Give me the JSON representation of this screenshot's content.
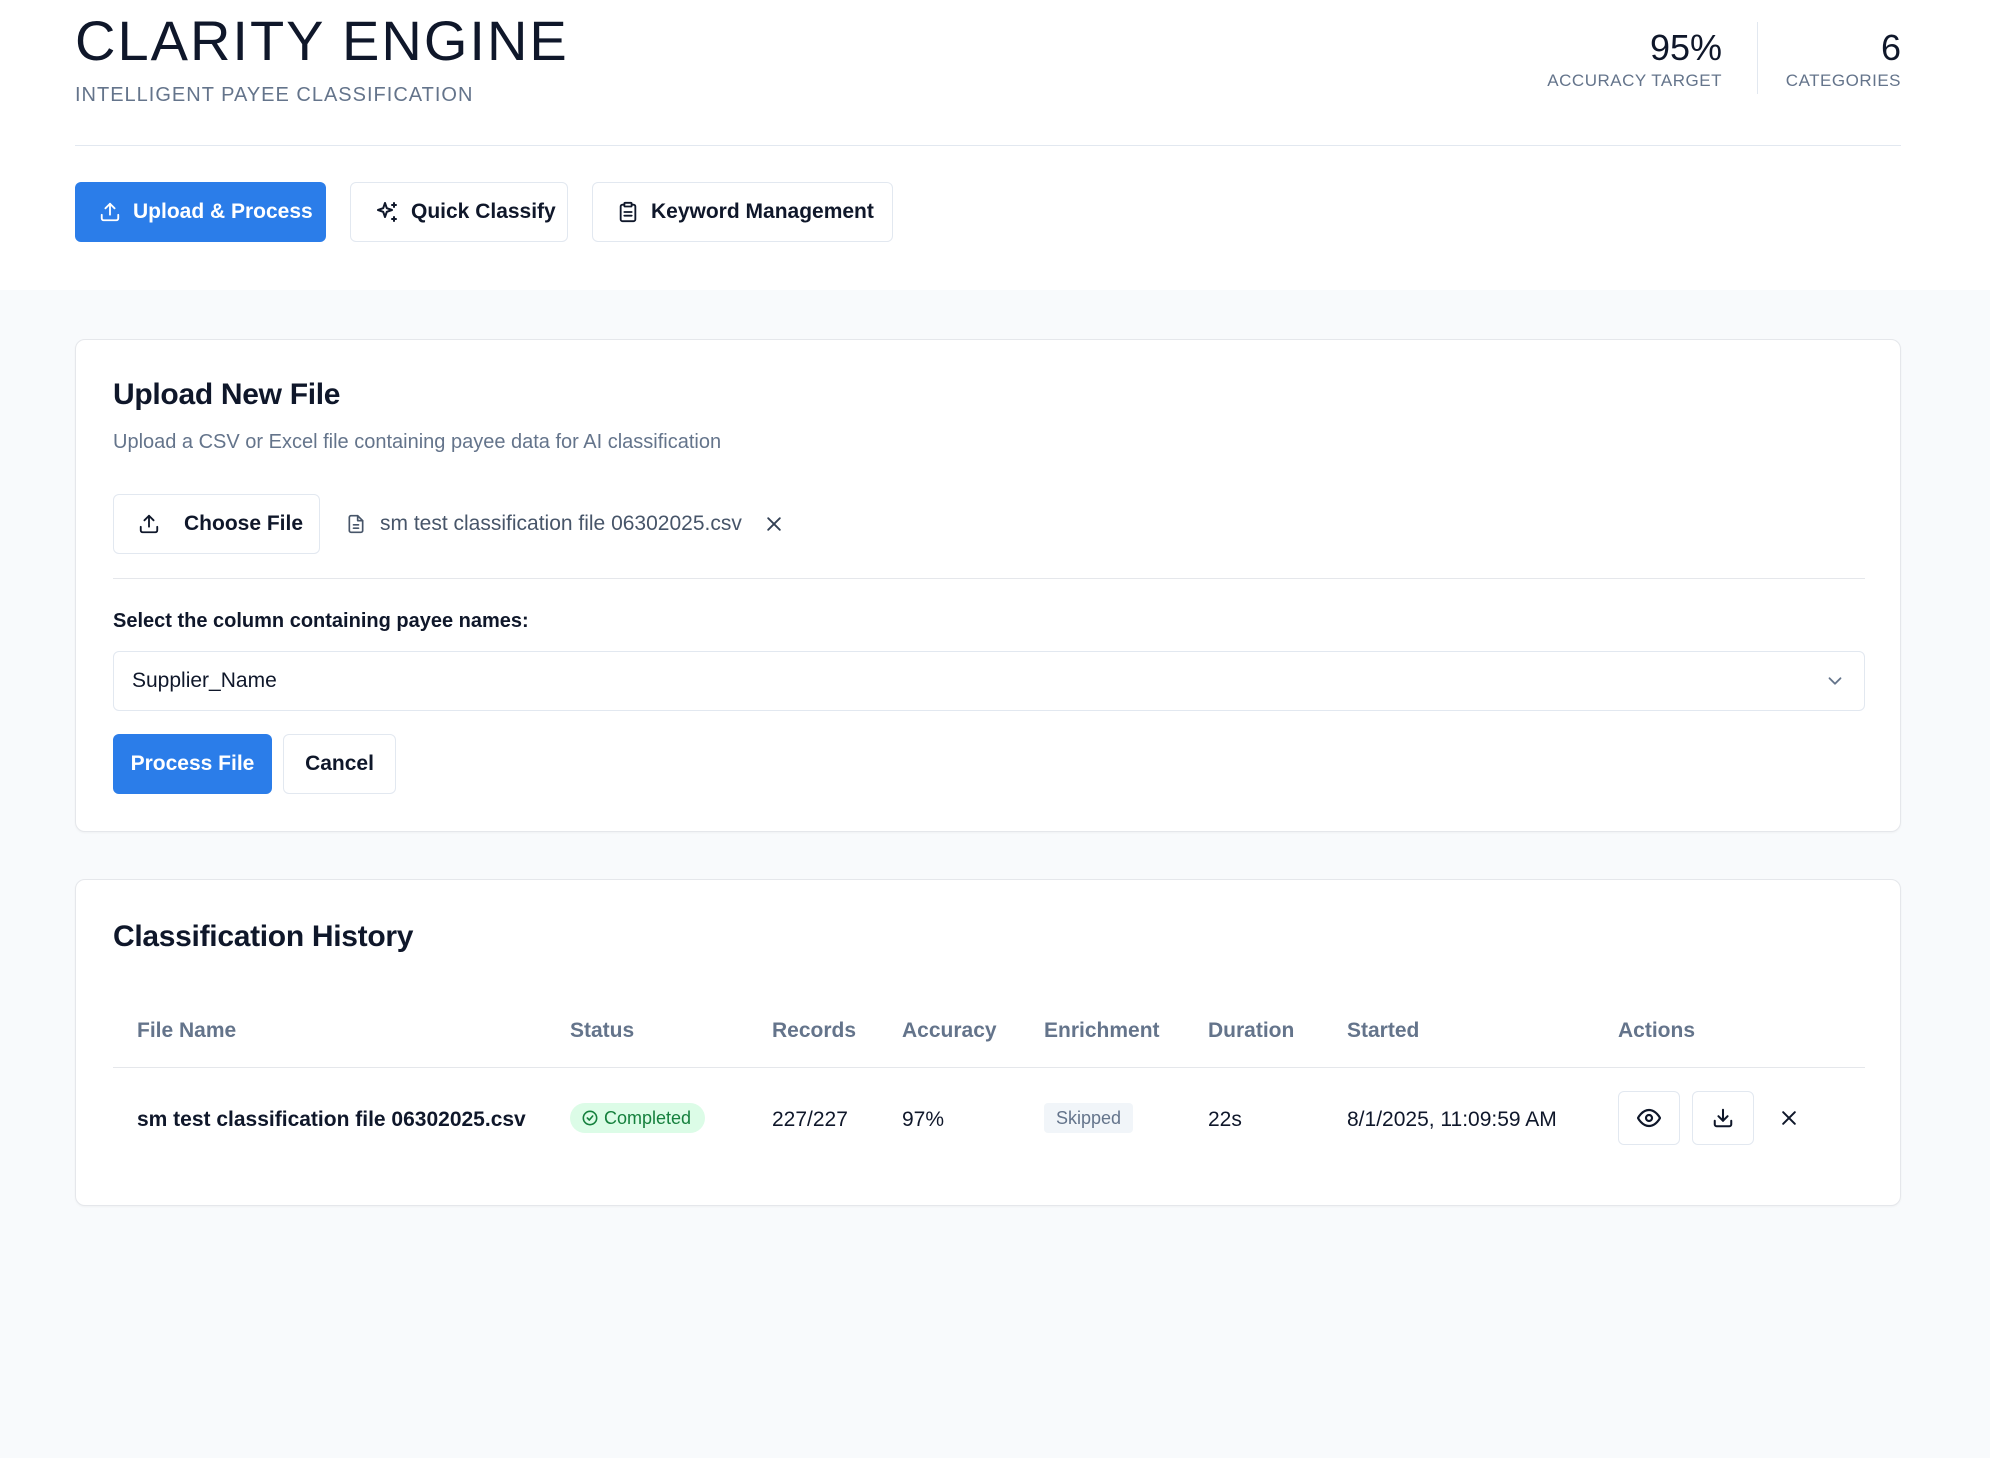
{
  "header": {
    "title": "CLARITY ENGINE",
    "subtitle": "INTELLIGENT PAYEE CLASSIFICATION",
    "stats": [
      {
        "value": "95%",
        "label": "ACCURACY TARGET"
      },
      {
        "value": "6",
        "label": "CATEGORIES"
      }
    ]
  },
  "tabs": [
    {
      "label": "Upload & Process",
      "icon": "upload-icon",
      "active": true
    },
    {
      "label": "Quick Classify",
      "icon": "sparkles-icon",
      "active": false
    },
    {
      "label": "Keyword Management",
      "icon": "clipboard-icon",
      "active": false
    }
  ],
  "upload": {
    "title": "Upload New File",
    "description": "Upload a CSV or Excel file containing payee data for AI classification",
    "choose_label": "Choose File",
    "selected_file": "sm test classification file 06302025.csv",
    "column_label": "Select the column containing payee names:",
    "column_value": "Supplier_Name",
    "process_label": "Process File",
    "cancel_label": "Cancel"
  },
  "history": {
    "title": "Classification History",
    "columns": [
      "File Name",
      "Status",
      "Records",
      "Accuracy",
      "Enrichment",
      "Duration",
      "Started",
      "Actions"
    ],
    "rows": [
      {
        "file_name": "sm test classification file 06302025.csv",
        "status": "Completed",
        "records": "227/227",
        "accuracy": "97%",
        "enrichment": "Skipped",
        "duration": "22s",
        "started": "8/1/2025, 11:09:59 AM"
      }
    ]
  },
  "colors": {
    "primary": "#2b7de9",
    "success_bg": "#dcfce7",
    "success_text": "#15803d",
    "muted": "#64748b",
    "border": "#e2e8f0"
  }
}
